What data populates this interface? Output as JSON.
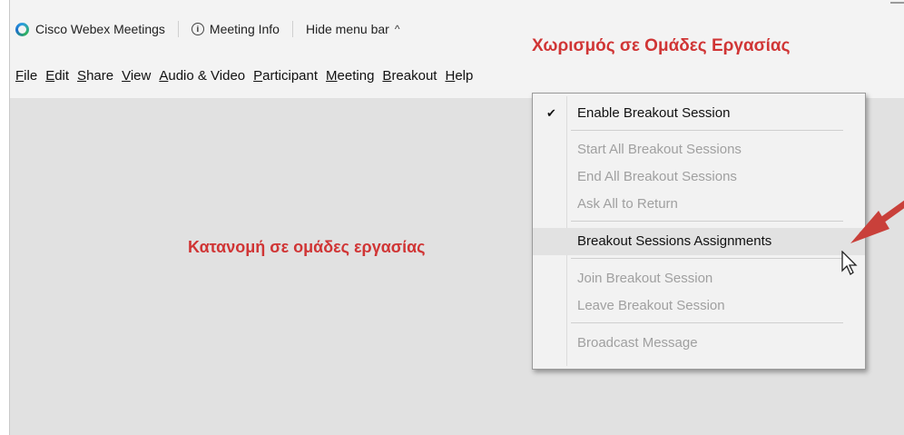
{
  "app": {
    "name": "Cisco Webex Meetings",
    "meeting_info": "Meeting Info",
    "hide_menu_bar": "Hide menu bar",
    "chevron_up": "^"
  },
  "menubar": {
    "items": [
      {
        "label": "File",
        "underline": "F"
      },
      {
        "label": "Edit",
        "underline": "E"
      },
      {
        "label": "Share",
        "underline": "S"
      },
      {
        "label": "View",
        "underline": "V"
      },
      {
        "label": "Audio & Video",
        "underline": "A"
      },
      {
        "label": "Participant",
        "underline": "P"
      },
      {
        "label": "Meeting",
        "underline": "M"
      },
      {
        "label": "Breakout",
        "underline": "B"
      },
      {
        "label": "Help",
        "underline": "H"
      }
    ]
  },
  "breakout_menu": {
    "items": [
      {
        "label": "Enable Breakout Session",
        "checked": true,
        "enabled": true
      },
      {
        "label": "Start All Breakout Sessions",
        "enabled": false
      },
      {
        "label": "End All Breakout Sessions",
        "enabled": false
      },
      {
        "label": "Ask All to Return",
        "enabled": false
      },
      {
        "label": "Breakout Sessions Assignments",
        "enabled": true,
        "highlighted": true
      },
      {
        "label": "Join Breakout Session",
        "enabled": false
      },
      {
        "label": "Leave Breakout Session",
        "enabled": false
      },
      {
        "label": "Broadcast Message",
        "enabled": false
      }
    ],
    "checkmark": "✔"
  },
  "annotations": {
    "title": "Χωρισμός σε Ομάδες Εργασίας",
    "side": "Κατανομή σε ομάδες εργασίας",
    "color": "#d03535"
  }
}
